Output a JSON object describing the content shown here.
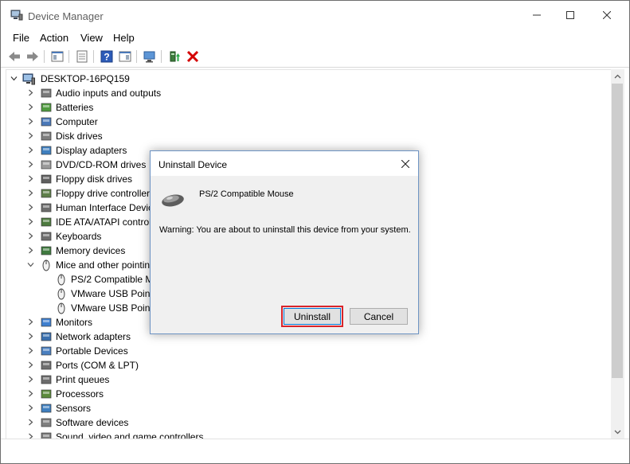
{
  "window": {
    "title": "Device Manager"
  },
  "menu": {
    "items": [
      "File",
      "Action",
      "View",
      "Help"
    ]
  },
  "tree": {
    "root": "DESKTOP-16PQ159",
    "items": [
      {
        "label": "Audio inputs and outputs",
        "icon": "speaker-icon",
        "expanded": false,
        "level": 1
      },
      {
        "label": "Batteries",
        "icon": "battery-icon",
        "expanded": false,
        "level": 1
      },
      {
        "label": "Computer",
        "icon": "computer-icon",
        "expanded": false,
        "level": 1
      },
      {
        "label": "Disk drives",
        "icon": "disk-drive-icon",
        "expanded": false,
        "level": 1
      },
      {
        "label": "Display adapters",
        "icon": "display-adapter-icon",
        "expanded": false,
        "level": 1
      },
      {
        "label": "DVD/CD-ROM drives",
        "icon": "dvd-drive-icon",
        "expanded": false,
        "level": 1
      },
      {
        "label": "Floppy disk drives",
        "icon": "floppy-disk-icon",
        "expanded": false,
        "level": 1
      },
      {
        "label": "Floppy drive controller",
        "icon": "floppy-controller-icon",
        "expanded": false,
        "level": 1
      },
      {
        "label": "Human Interface Devic",
        "icon": "hid-icon",
        "expanded": false,
        "level": 1
      },
      {
        "label": "IDE ATA/ATAPI control",
        "icon": "ide-controller-icon",
        "expanded": false,
        "level": 1
      },
      {
        "label": "Keyboards",
        "icon": "keyboard-icon",
        "expanded": false,
        "level": 1
      },
      {
        "label": "Memory devices",
        "icon": "memory-icon",
        "expanded": false,
        "level": 1
      },
      {
        "label": "Mice and other pointin",
        "icon": "mouse-icon",
        "expanded": true,
        "level": 1
      },
      {
        "label": "PS/2 Compatible M",
        "icon": "mouse-icon",
        "level": 2
      },
      {
        "label": "VMware USB Pointi",
        "icon": "mouse-icon",
        "level": 2
      },
      {
        "label": "VMware USB Pointi",
        "icon": "mouse-icon",
        "level": 2
      },
      {
        "label": "Monitors",
        "icon": "monitor-icon",
        "expanded": false,
        "level": 1
      },
      {
        "label": "Network adapters",
        "icon": "network-adapter-icon",
        "expanded": false,
        "level": 1
      },
      {
        "label": "Portable Devices",
        "icon": "portable-device-icon",
        "expanded": false,
        "level": 1
      },
      {
        "label": "Ports (COM & LPT)",
        "icon": "port-icon",
        "expanded": false,
        "level": 1
      },
      {
        "label": "Print queues",
        "icon": "printer-icon",
        "expanded": false,
        "level": 1
      },
      {
        "label": "Processors",
        "icon": "processor-icon",
        "expanded": false,
        "level": 1
      },
      {
        "label": "Sensors",
        "icon": "sensor-icon",
        "expanded": false,
        "level": 1
      },
      {
        "label": "Software devices",
        "icon": "software-device-icon",
        "expanded": false,
        "level": 1
      },
      {
        "label": "Sound, video and game controllers",
        "icon": "sound-icon",
        "expanded": false,
        "level": 1
      }
    ]
  },
  "dialog": {
    "title": "Uninstall Device",
    "device_name": "PS/2 Compatible Mouse",
    "warning": "Warning: You are about to uninstall this device from your system.",
    "uninstall_label": "Uninstall",
    "cancel_label": "Cancel"
  },
  "colors": {
    "highlight": "#d9242a",
    "accent": "#0078d7",
    "delete_red": "#d40000"
  }
}
